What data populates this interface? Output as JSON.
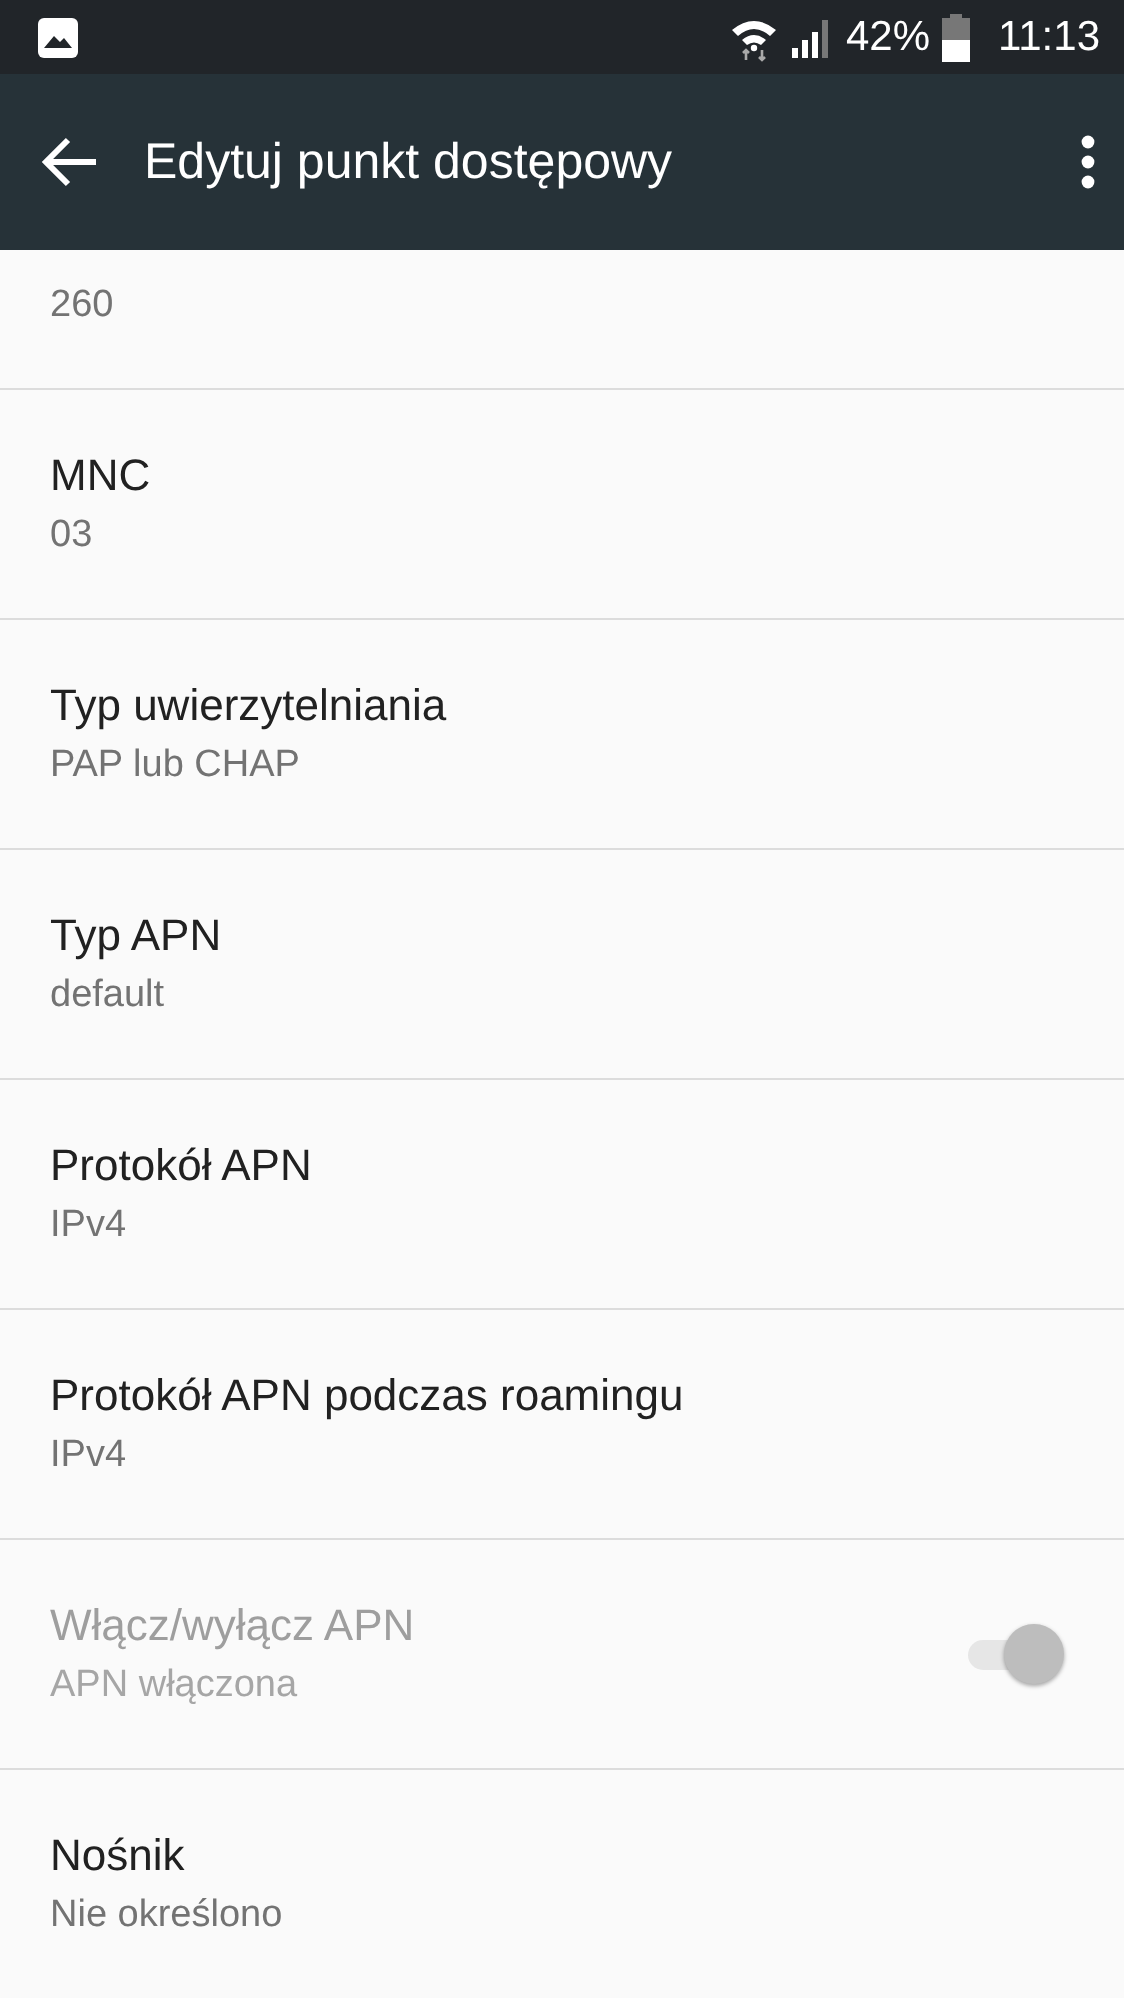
{
  "status_bar": {
    "battery_text": "42%",
    "time": "11:13"
  },
  "app_bar": {
    "title": "Edytuj punkt dostępowy"
  },
  "items": [
    {
      "kind": "text",
      "summary": "260",
      "disabled": false
    },
    {
      "kind": "text",
      "title": "MNC",
      "summary": "03",
      "disabled": false
    },
    {
      "kind": "text",
      "title": "Typ uwierzytelniania",
      "summary": "PAP lub CHAP",
      "disabled": false
    },
    {
      "kind": "text",
      "title": "Typ APN",
      "summary": "default",
      "disabled": false
    },
    {
      "kind": "text",
      "title": "Protokół APN",
      "summary": "IPv4",
      "disabled": false
    },
    {
      "kind": "text",
      "title": "Protokół APN podczas roamingu",
      "summary": "IPv4",
      "disabled": false
    },
    {
      "kind": "switch",
      "title": "Włącz/wyłącz APN",
      "summary": "APN włączona",
      "disabled": true,
      "on": true
    },
    {
      "kind": "text",
      "title": "Nośnik",
      "summary": "Nie określono",
      "disabled": false
    }
  ]
}
